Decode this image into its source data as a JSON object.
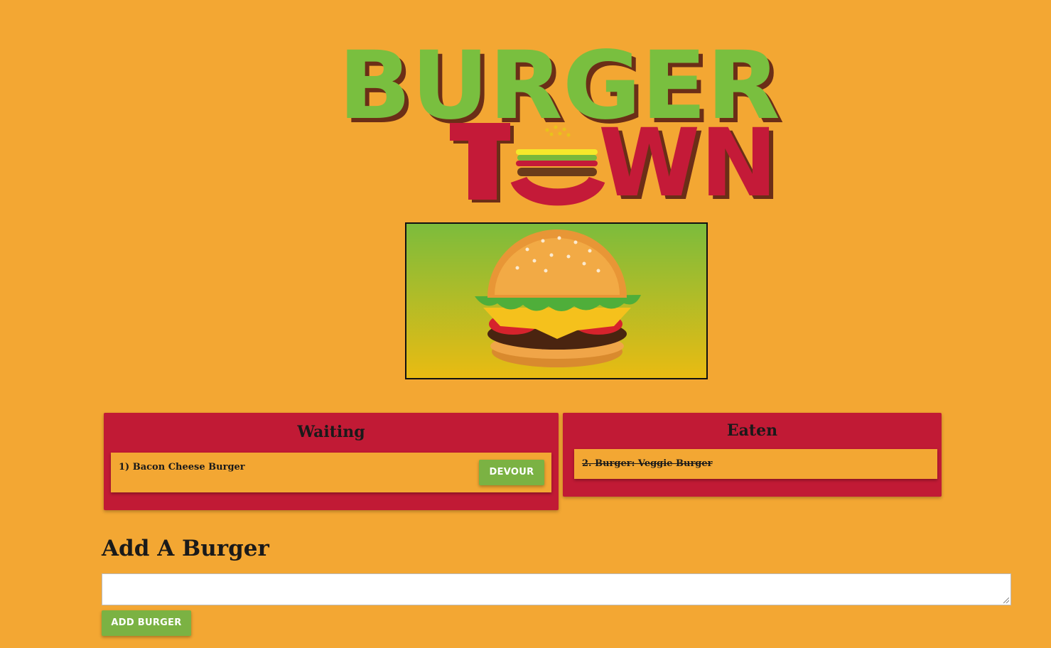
{
  "logo": {
    "line1": "BURGER",
    "line2": "TOWN"
  },
  "hero_image": {
    "alt": "burger-illustration"
  },
  "waiting": {
    "title": "Waiting",
    "items": [
      {
        "text": "1) Bacon Cheese Burger",
        "button": "Devour"
      }
    ]
  },
  "eaten": {
    "title": "Eaten",
    "items": [
      {
        "text": "2. Burger: Veggie Burger"
      }
    ]
  },
  "add": {
    "heading": "Add A Burger",
    "input_value": "",
    "button": "Add Burger"
  },
  "colors": {
    "background": "#f3a733",
    "panel": "#c11a35",
    "button": "#7bb243",
    "logo_green": "#79bf3f",
    "logo_red": "#c41a38"
  }
}
